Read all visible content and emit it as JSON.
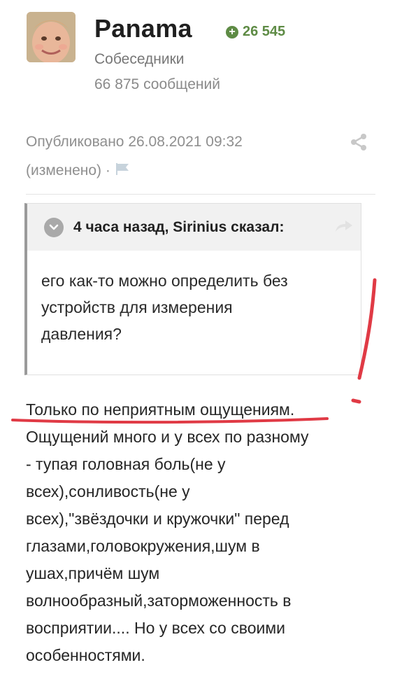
{
  "author": {
    "username": "Panama",
    "reputation": "26 545",
    "group": "Собеседники",
    "post_count": "66 875 сообщений"
  },
  "meta": {
    "published": "Опубликовано 26.08.2021 09:32",
    "edited": "(изменено) ·"
  },
  "quote": {
    "header": "4 часа назад, Sirinius сказал:",
    "lines": [
      "его как-то можно определить без",
      "устройств для измерения",
      "давления?"
    ]
  },
  "post": {
    "lines": [
      "Только по неприятным ощущениям.",
      "Ощущений много и у всех по разному",
      "- тупая головная боль(не у",
      "всех),сонливость(не у",
      "всех),\"звёздочки и кружочки\" перед",
      "глазами,головокружения,шум в",
      "ушах,причём шум",
      "волнообразный,заторможенность в",
      "восприятии.... Но у всех со своими",
      "особенностями."
    ]
  },
  "icons": {
    "reputation": "plus-circle-icon",
    "share": "share-icon",
    "report": "flag-icon",
    "expand": "chevron-down-icon",
    "go_to_quote": "arrow-share-icon"
  },
  "colors": {
    "reputation": "#5e8b45",
    "annotation": "#e03a45"
  }
}
